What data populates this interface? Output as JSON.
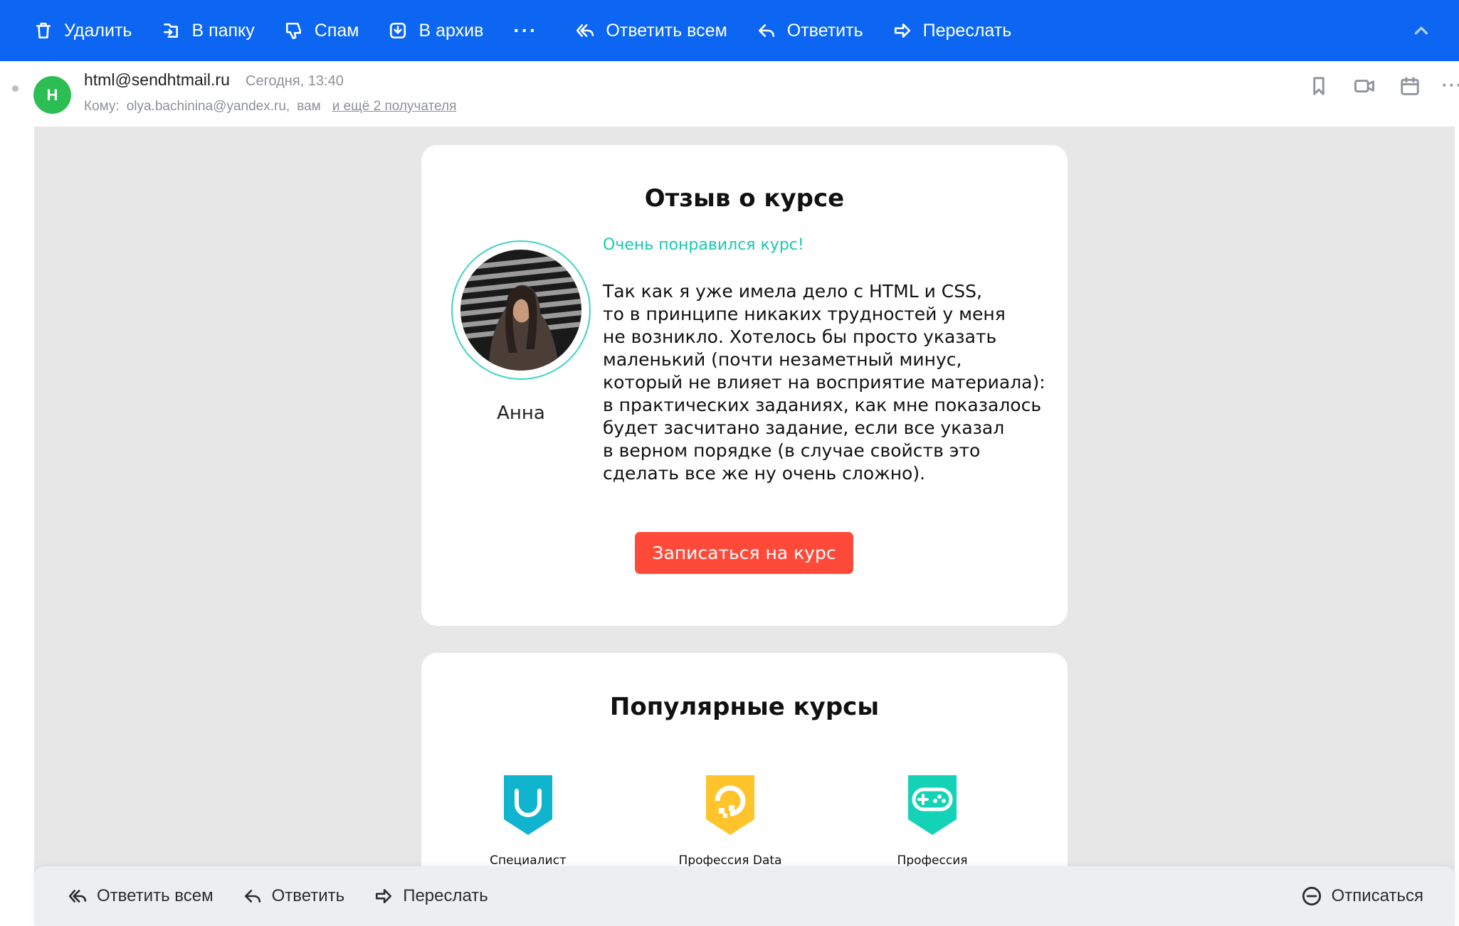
{
  "toolbar": {
    "delete": "Удалить",
    "to_folder": "В папку",
    "spam": "Спам",
    "archive": "В архив",
    "more": "···",
    "reply_all": "Ответить всем",
    "reply": "Ответить",
    "forward": "Переслать"
  },
  "header": {
    "avatar_letter": "H",
    "from": "html@sendhtmail.ru",
    "date": "Сегодня, 13:40",
    "to_label": "Кому:",
    "to_address": "olya.bachinina@yandex.ru,",
    "to_you": "вам",
    "to_more": "и ещё 2 получателя",
    "more": "···"
  },
  "review_card": {
    "title": "Отзыв о курсе",
    "reviewer_name": "Анна",
    "headline": "Очень понравился курс!",
    "text": "Так как я уже имела дело с HTML и CSS,\nто в принципе никаких трудностей у меня\nне возникло. Хотелось бы просто указать\nмаленький (почти незаметный минус,\nкоторый не влияет на восприятие материала):\nв практических заданиях, как мне показалось\nбудет засчитано задание, если все указал\nв верном порядке (в случае свойств это\nсделать все же ну очень сложно).",
    "cta_label": "Записаться на курс"
  },
  "popular_card": {
    "title": "Популярные курсы",
    "courses": [
      {
        "label": "Специалист",
        "color": "#10b4cf",
        "icon": "shield-icon"
      },
      {
        "label": "Профессия Data",
        "color": "#ffc42b",
        "icon": "data-icon"
      },
      {
        "label": "Профессия",
        "color": "#14d2b6",
        "icon": "gamepad-icon"
      }
    ]
  },
  "bottom_bar": {
    "reply_all": "Ответить всем",
    "reply": "Ответить",
    "forward": "Переслать",
    "unsubscribe": "Отписаться"
  },
  "colors": {
    "toolbar_bg": "#0c66f1",
    "avatar_bg": "#2cbd53",
    "accent_teal": "#18c8b4",
    "cta": "#ff4a3a",
    "body_bg": "#e7e7e7"
  }
}
